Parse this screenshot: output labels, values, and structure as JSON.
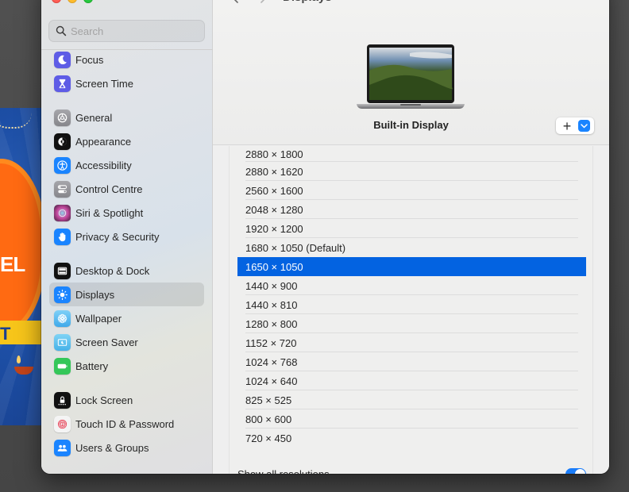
{
  "window": {
    "page_title": "Displays",
    "search": {
      "placeholder": "Search",
      "value": ""
    }
  },
  "sidebar": {
    "groups": [
      [
        {
          "label": "Focus",
          "icon": "moon-icon",
          "color": "#5e5ce6"
        },
        {
          "label": "Screen Time",
          "icon": "hourglass-icon",
          "color": "#5e5ce6"
        }
      ],
      [
        {
          "label": "General",
          "icon": "gear-icon",
          "color": "#8e8e93"
        },
        {
          "label": "Appearance",
          "icon": "appearance-icon",
          "color": "#111111"
        },
        {
          "label": "Accessibility",
          "icon": "accessibility-icon",
          "color": "#1a84ff"
        },
        {
          "label": "Control Centre",
          "icon": "control-centre-icon",
          "color": "#8e8e93"
        },
        {
          "label": "Siri & Spotlight",
          "icon": "siri-icon",
          "color": "#6b2b5e"
        },
        {
          "label": "Privacy & Security",
          "icon": "hand-icon",
          "color": "#1a84ff"
        }
      ],
      [
        {
          "label": "Desktop & Dock",
          "icon": "dock-icon",
          "color": "#111111"
        },
        {
          "label": "Displays",
          "icon": "sun-icon",
          "color": "#1a84ff",
          "active": true
        },
        {
          "label": "Wallpaper",
          "icon": "flower-icon",
          "color": "#4fb7f2"
        },
        {
          "label": "Screen Saver",
          "icon": "screen-saver-icon",
          "color": "#58bff0"
        },
        {
          "label": "Battery",
          "icon": "battery-icon",
          "color": "#34c759"
        }
      ],
      [
        {
          "label": "Lock Screen",
          "icon": "lock-icon",
          "color": "#111111"
        },
        {
          "label": "Touch ID & Password",
          "icon": "fingerprint-icon",
          "color": "#f4f4f4"
        },
        {
          "label": "Users & Groups",
          "icon": "users-icon",
          "color": "#1a84ff"
        }
      ]
    ]
  },
  "main": {
    "display_name": "Built-in Display",
    "add_button_label": "+",
    "resolutions": [
      "2880 × 1800",
      "2880 × 1620",
      "2560 × 1600",
      "2048 × 1280",
      "1920 × 1200",
      "1680 × 1050 (Default)",
      "1650 × 1050",
      "1440 × 900",
      "1440 × 810",
      "1280 × 800",
      "1152 × 720",
      "1024 × 768",
      "1024 × 640",
      "825 × 525",
      "800 × 600",
      "720 × 450"
    ],
    "selected_resolution": "1650 × 1050",
    "show_all_label": "Show all resolutions",
    "show_all_enabled": true
  },
  "background_window": {
    "visible_text_1": "EL",
    "visible_text_2": "T"
  },
  "colors": {
    "accent": "#0363e1",
    "toggle_on": "#1a7dfa"
  }
}
